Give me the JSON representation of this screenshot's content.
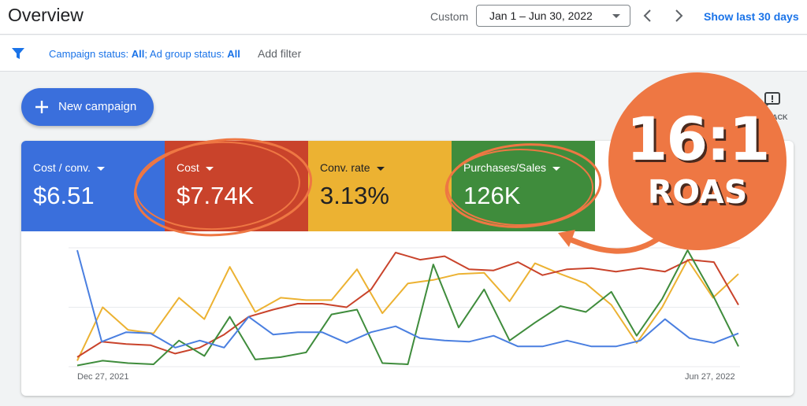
{
  "header": {
    "title": "Overview",
    "custom_label": "Custom",
    "date_range": "Jan 1 – Jun 30, 2022",
    "show_last_30": "Show last 30 days"
  },
  "filters": {
    "campaign_status_label": "Campaign status: ",
    "campaign_status_value": "All",
    "separator": "; ",
    "ad_group_status_label": "Ad group status: ",
    "ad_group_status_value": "All",
    "add_filter": "Add filter"
  },
  "actions": {
    "new_campaign": "New campaign",
    "feedback_partial": "ACK"
  },
  "metrics": [
    {
      "label": "Cost / conv.",
      "value": "$6.51",
      "color": "#3a6fdc"
    },
    {
      "label": "Cost",
      "value": "$7.74K",
      "color": "#c9432b"
    },
    {
      "label": "Conv. rate",
      "value": "3.13%",
      "color": "#ecb232"
    },
    {
      "label": "Purchases/Sales",
      "value": "126K",
      "color": "#3f8c3c"
    }
  ],
  "annotation": {
    "ratio": "16:1",
    "label": "ROAS",
    "color": "#ee7743"
  },
  "chart_data": {
    "type": "line",
    "x_start_label": "Dec 27, 2021",
    "x_end_label": "Jun 27, 2022",
    "ylim": [
      0,
      100
    ],
    "grid": true,
    "series": [
      {
        "name": "Cost / conv.",
        "color": "#4a7fe0",
        "values": [
          98,
          21,
          29,
          28,
          16,
          22,
          16,
          42,
          27,
          29,
          29,
          20,
          29,
          34,
          24,
          22,
          21,
          26,
          17,
          17,
          22,
          17,
          17,
          22,
          40,
          24,
          20,
          28
        ]
      },
      {
        "name": "Cost",
        "color": "#c9432b",
        "values": [
          8,
          21,
          19,
          18,
          11,
          16,
          27,
          42,
          48,
          53,
          53,
          50,
          65,
          96,
          90,
          93,
          82,
          81,
          88,
          77,
          82,
          83,
          80,
          83,
          80,
          90,
          88,
          52
        ]
      },
      {
        "name": "Conv. rate",
        "color": "#ecb232",
        "values": [
          5,
          50,
          31,
          28,
          58,
          40,
          84,
          46,
          58,
          56,
          56,
          82,
          45,
          70,
          73,
          78,
          79,
          55,
          87,
          78,
          70,
          52,
          20,
          50,
          90,
          58,
          78
        ]
      },
      {
        "name": "Purchases/Sales",
        "color": "#3f8c3c",
        "values": [
          1,
          5,
          3,
          2,
          22,
          9,
          42,
          6,
          8,
          12,
          44,
          48,
          3,
          2,
          86,
          33,
          65,
          22,
          37,
          51,
          46,
          63,
          26,
          57,
          98,
          60,
          17
        ]
      }
    ]
  }
}
